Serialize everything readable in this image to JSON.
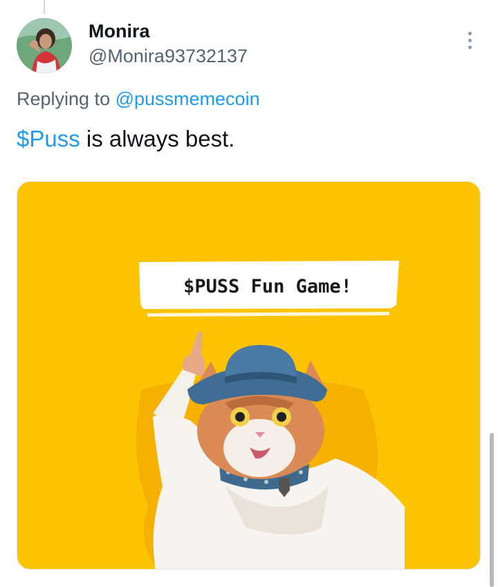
{
  "tweet": {
    "author_name": "Monira",
    "author_handle": "@Monira93732137",
    "replying_prefix": "Replying to ",
    "replying_handle": "@pussmemecoin",
    "text_cashtag": "$Puss",
    "text_rest": " is always best."
  },
  "media": {
    "banner_text": "$PUSS Fun Game!",
    "background_color": "#fcc400"
  },
  "colors": {
    "link": "#1d9bf0",
    "secondary_text": "#536471",
    "primary_text": "#0f1419"
  },
  "icons": [
    "more-options-icon"
  ]
}
